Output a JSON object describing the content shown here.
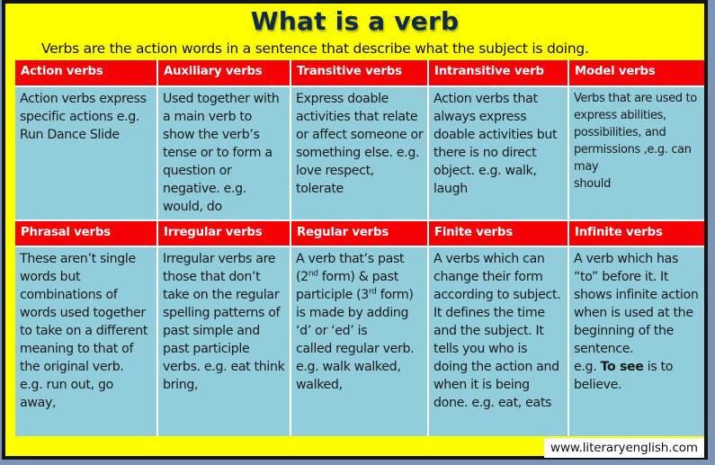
{
  "title": "What is a verb",
  "subtitle": "Verbs are the action words in a sentence that describe what the subject is doing.",
  "colors": {
    "header_red": "#f50005",
    "cell_blue": "#92cddc",
    "background_yellow": "#ffff00",
    "title_navy": "#0f2a4a"
  },
  "rows": [
    {
      "headers": [
        "Action verbs",
        "Auxiliary verbs",
        "Transitive verbs",
        "Intransitive verb",
        "Model verbs"
      ],
      "descriptions": [
        "Action verbs express specific actions e.g. Run Dance Slide",
        "Used together with a main verb to show the verb’s tense or to form a question or negative. e.g. would, do",
        "Express doable activities that relate or affect someone or something else. e.g. love respect, tolerate",
        "Action verbs that always express doable activities but there is no direct object. e.g. walk, laugh",
        "Verbs that are used to express abilities, possibilities, and permissions ,e.g. can may should"
      ]
    },
    {
      "headers": [
        "Phrasal verbs",
        "Irregular verbs",
        "Regular verbs",
        "Finite verbs",
        "Infinite verbs"
      ],
      "descriptions": [
        "These aren’t single words but combinations of words used together to take on a different meaning to that of the original verb. e.g. run out, go away,",
        "Irregular verbs are those that don’t take on the regular spelling patterns of past simple and past participle verbs. e.g. eat think bring,",
        "A verb that’s past (2nd form) & past participle (3rd form) is made by adding ‘d’ or ‘ed’ is called regular verb. e.g. walk walked, walked,",
        "A verbs which can change their form according to subject. It defines the time and the subject. It tells you who is doing the action and when it is being done. e.g.  eat, eats",
        "A verb which has “to” before it. It shows infinite action when is used at the beginning of the sentence. e.g. To see is to believe."
      ]
    }
  ],
  "rich": {
    "model_line1": "Verbs that are used to express abilities, possibilities, and permissions ,e.g. can",
    "model_line2": "may",
    "model_line3": "should",
    "regular_p1": "A verb that’s past (2",
    "regular_sup1": "nd",
    "regular_p2": " form) & past participle (3",
    "regular_sup2": "rd",
    "regular_p3": " form) is made by adding ‘d’ or ‘ed’ is",
    "regular_p4": "called regular verb. e.g. walk walked, walked,",
    "infinite_p1": "A verb which has “to” before it. It shows infinite action when is used at the beginning of the sentence.",
    "infinite_p2": "e.g. ",
    "infinite_bold": "To see",
    "infinite_p3": " is to believe.",
    "phrasal_p1": "These aren’t single words but combinations of words used together to take on a different meaning to that of the original verb.",
    "phrasal_p2": "e.g. run out, go away,"
  },
  "watermark": "www.literaryenglish.com"
}
